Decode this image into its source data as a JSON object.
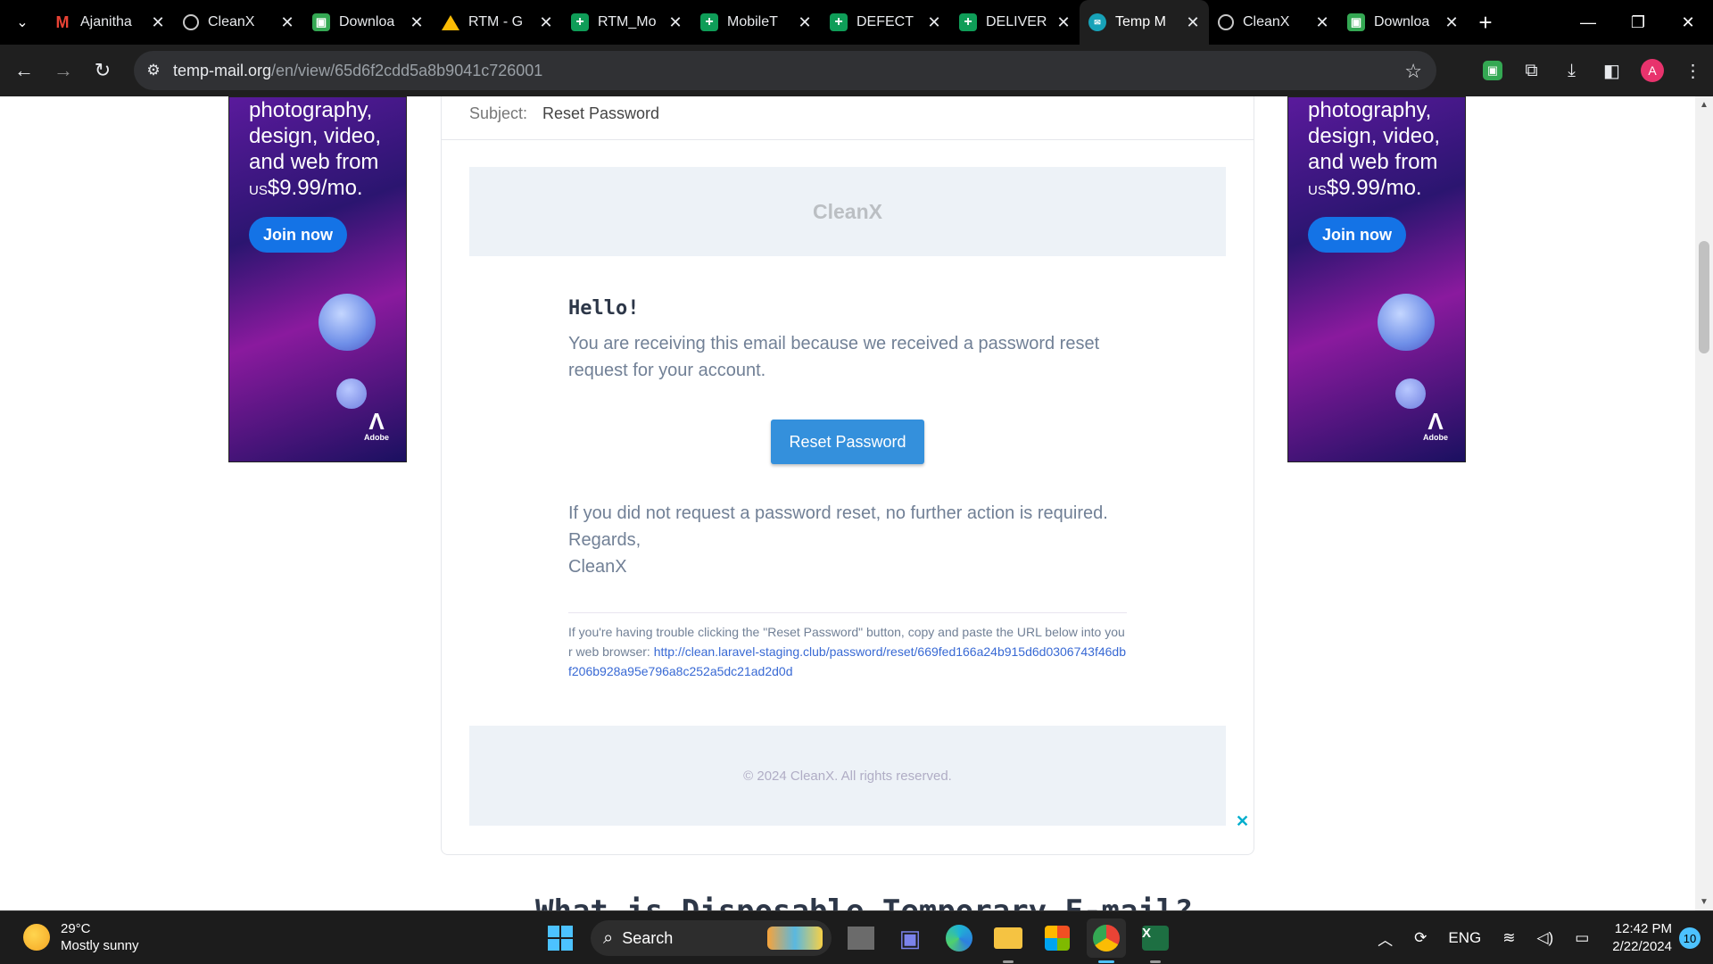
{
  "browser": {
    "tabs": [
      {
        "title": "Ajanitha",
        "icon": "gmail-icon"
      },
      {
        "title": "CleanX",
        "icon": "globe-icon"
      },
      {
        "title": "Downloa",
        "icon": "download-ext-icon"
      },
      {
        "title": "RTM - G",
        "icon": "google-drive-icon"
      },
      {
        "title": "RTM_Mo",
        "icon": "google-sheets-icon"
      },
      {
        "title": "MobileT",
        "icon": "google-sheets-icon"
      },
      {
        "title": "DEFECT",
        "icon": "google-sheets-icon"
      },
      {
        "title": "DELIVER",
        "icon": "google-sheets-icon"
      },
      {
        "title": "Temp M",
        "icon": "temp-mail-icon",
        "active": true
      },
      {
        "title": "CleanX",
        "icon": "globe-icon"
      },
      {
        "title": "Downloa",
        "icon": "download-ext-icon"
      }
    ],
    "url_host": "temp-mail.org",
    "url_path": "/en/view/65d6f2cdd5a8b9041c726001",
    "profile_initial": "A"
  },
  "ad": {
    "text_line1": "photography,",
    "text_line2": "design, video,",
    "text_line3": "and web from",
    "price_prefix": "US",
    "price": "$9.99/mo.",
    "cta": "Join now",
    "brand": "Adobe"
  },
  "email": {
    "subject_label": "Subject:",
    "subject": "Reset Password",
    "header_brand": "CleanX",
    "greeting": "Hello!",
    "intro": "You are receiving this email because we received a password reset request for your account.",
    "button_label": "Reset Password",
    "outro": "If you did not request a password reset, no further action is required.",
    "regards": "Regards,",
    "signature": "CleanX",
    "subcopy_text": "If you're having trouble clicking the \"Reset Password\" button, copy and paste the URL below into your web browser:",
    "subcopy_link": "http://clean.laravel-staging.club/password/reset/669fed166a24b915d6d0306743f46dbf206b928a95e796a8c252a5dc21ad2d0d",
    "footer": "© 2024 CleanX. All rights reserved."
  },
  "page": {
    "next_heading": "What is Disposable Temporary E-mail?"
  },
  "taskbar": {
    "temperature": "29°C",
    "weather": "Mostly sunny",
    "search_label": "Search",
    "language": "ENG",
    "time": "12:42 PM",
    "date": "2/22/2024",
    "notification_count": "10"
  }
}
